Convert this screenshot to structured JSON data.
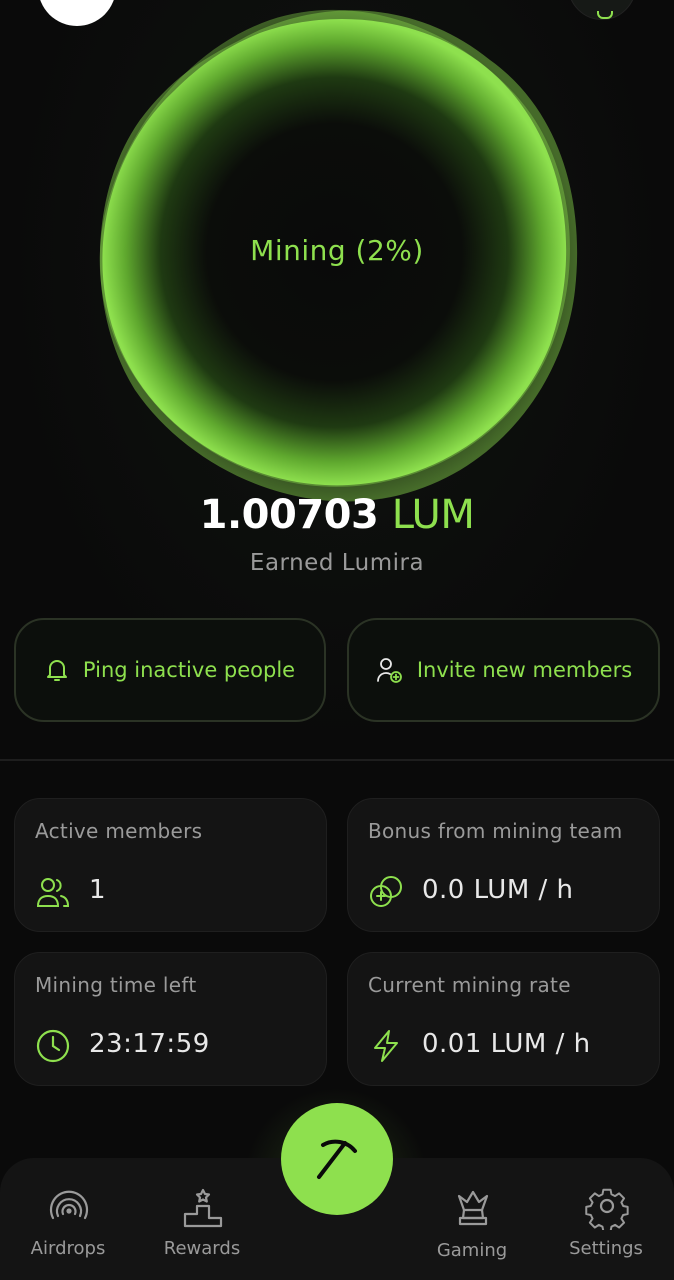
{
  "orb": {
    "label": "Mining (2%)",
    "progress_percent": 2
  },
  "balance": {
    "amount": "1.00703",
    "unit": "LUM",
    "caption": "Earned Lumira"
  },
  "actions": {
    "ping_label": "Ping inactive people",
    "invite_label": "Invite new members"
  },
  "stats": {
    "active_members": {
      "title": "Active members",
      "value": "1",
      "icon": "users-icon"
    },
    "bonus": {
      "title": "Bonus from mining team",
      "value": "0.0 LUM / h",
      "icon": "coins-icon"
    },
    "time_left": {
      "title": "Mining time left",
      "value": "23:17:59",
      "icon": "clock-icon"
    },
    "rate": {
      "title": "Current mining rate",
      "value": "0.01 LUM / h",
      "icon": "lightning-icon"
    }
  },
  "nav": {
    "airdrops": "Airdrops",
    "rewards": "Rewards",
    "gaming": "Gaming",
    "settings": "Settings",
    "center_icon": "pickaxe-icon"
  },
  "colors": {
    "accent": "#8ee04e",
    "background": "#0a0a0a",
    "card": "#141414",
    "muted": "#9a9a9a"
  }
}
